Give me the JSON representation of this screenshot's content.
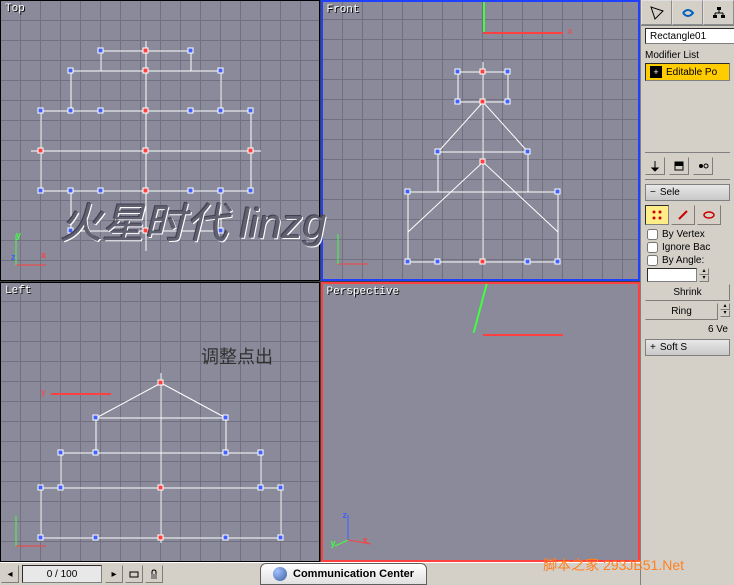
{
  "viewports": {
    "top": {
      "label": "Top"
    },
    "front": {
      "label": "Front"
    },
    "left": {
      "label": "Left"
    },
    "perspective": {
      "label": "Perspective"
    }
  },
  "annotation": {
    "text": "调整点出"
  },
  "watermark": {
    "main": "火星时代 linzg",
    "corner": "脚本之家 293JB51.Net"
  },
  "sidebar": {
    "object_name": "Rectangle01",
    "modifier_list_label": "Modifier List",
    "modifier": {
      "name": "Editable Po"
    },
    "selection": {
      "header": "Sele",
      "by_vertex": "By Vertex",
      "ignore_bac": "Ignore Bac",
      "by_angle": "By Angle:",
      "shrink": "Shrink",
      "ring": "Ring",
      "selected_info": "6 Ve"
    },
    "soft_sel": {
      "header": "Soft S"
    }
  },
  "statusbar": {
    "frame": "0 / 100"
  },
  "comm_center": {
    "title": "Communication Center"
  },
  "axes": {
    "x": "x",
    "y": "y",
    "z": "z"
  }
}
